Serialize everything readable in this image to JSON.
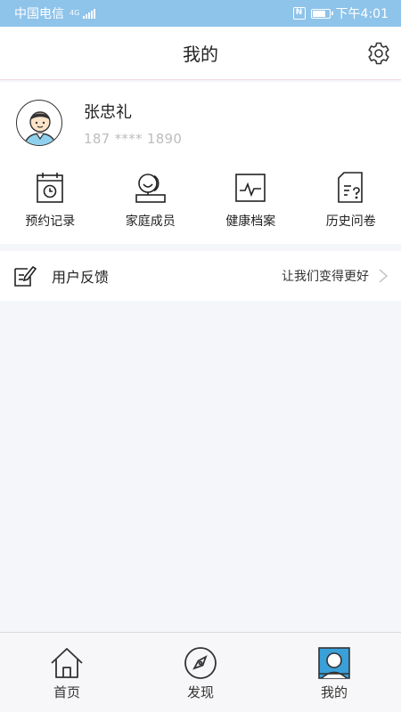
{
  "status_bar": {
    "carrier": "中国电信",
    "network": "4G",
    "time": "下午4:01"
  },
  "header": {
    "title": "我的",
    "settings_icon": "gear-icon"
  },
  "profile": {
    "name": "张忠礼",
    "phone": "187 **** 1890"
  },
  "quick_actions": [
    {
      "label": "预约记录",
      "icon": "calendar-clock-icon"
    },
    {
      "label": "家庭成员",
      "icon": "family-members-icon"
    },
    {
      "label": "健康档案",
      "icon": "health-record-icon"
    },
    {
      "label": "历史问卷",
      "icon": "questionnaire-icon"
    }
  ],
  "feedback": {
    "label": "用户反馈",
    "hint": "让我们变得更好"
  },
  "bottom_nav": [
    {
      "label": "首页",
      "icon": "home-icon",
      "active": false
    },
    {
      "label": "发现",
      "icon": "compass-icon",
      "active": false
    },
    {
      "label": "我的",
      "icon": "profile-icon",
      "active": true
    }
  ],
  "colors": {
    "status_bar": "#8ec3ea",
    "page_bg": "#f5f6fa",
    "icon_accent": "#3aa0d8"
  }
}
